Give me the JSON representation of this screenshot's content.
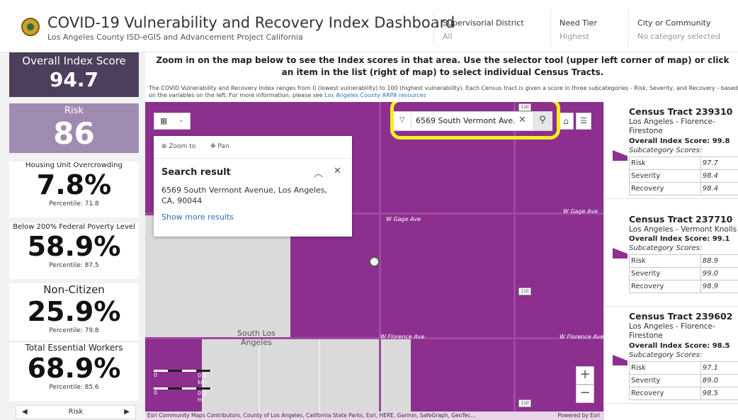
{
  "header": {
    "title": "COVID-19 Vulnerability and Recovery Index Dashboard",
    "subtitle": "Los Angeles County ISD-eGIS and Advancement Project California",
    "filters": [
      {
        "label": "Supervisorial District",
        "value": "All"
      },
      {
        "label": "Need Tier",
        "value": "Highest"
      },
      {
        "label": "City or Community",
        "value": "No category selected"
      }
    ]
  },
  "left": {
    "overall": {
      "label": "Overall Index Score",
      "value": "94.7"
    },
    "risk": {
      "label": "Risk",
      "value": "86"
    },
    "metrics": [
      {
        "label": "Housing Unit Overcrowding",
        "value": "7.8%",
        "percentile": "Percentile: 71.8"
      },
      {
        "label": "Below 200% Federal Poverty Level",
        "value": "58.9%",
        "percentile": "Percentile: 87.5"
      },
      {
        "label": "Non-Citizen",
        "value": "25.9%",
        "percentile": "Percentile: 79.8"
      },
      {
        "label": "Total Essential Workers",
        "value": "68.9%",
        "percentile": "Percentile: 85.6"
      }
    ],
    "pager": {
      "label": "Risk",
      "prev": "◀",
      "next": "▶"
    }
  },
  "instructions": {
    "main": "Zoom in on the map below to see the Index scores in that area. Use the selector tool (upper left corner of map) or click an item in the list (right of map) to select individual Census Tracts.",
    "desc": "The COVID Vulnerability and Recovery Index ranges from 0 (lowest vulnerability) to 100 (highest vulnerability). Each Census tract is given a score in three subcategories - Risk, Severity, and Recovery - based on the variables on the left. For more information, please see",
    "link": "Los Angeles County ARPA resources"
  },
  "map": {
    "popup": {
      "zoom_to": "Zoom to",
      "pan": "Pan",
      "title": "Search result",
      "address": "6569 South Vermont Avenue, Los Angeles, CA, 90044",
      "more": "Show more results"
    },
    "search": {
      "value": "6569 South Vermont Ave."
    },
    "roads": {
      "gage": "W Gage Ave",
      "gage2": "W Gage Ave",
      "florence": "W Florence Ave",
      "florence2": "W Florence Ave"
    },
    "place": "South Los\nAngeles",
    "shields": [
      "110",
      "110",
      "110"
    ],
    "scale": {
      "km": "0.4 km",
      "mi": "0.2 mi",
      "zero": "0"
    },
    "attribution": "Esri Community Maps Contributors, County of Los Angeles, California State Parks, Esri, HERE, Garmin, SafeGraph, GeoTec...",
    "powered": "Powered by Esri",
    "zoom_in": "+",
    "zoom_out": "−"
  },
  "tracts": [
    {
      "title": "Census Tract 239310",
      "location": "Los Angeles - Florence-Firestone",
      "overall": "Overall Index Score: 99.8",
      "sub": "Subcategory Scores:",
      "rows": [
        [
          "Risk",
          "97.7"
        ],
        [
          "Severity",
          "98.4"
        ],
        [
          "Recovery",
          "98.4"
        ]
      ]
    },
    {
      "title": "Census Tract 237710",
      "location": "Los Angeles - Vermont Knolls",
      "overall": "Overall Index Score: 99.1",
      "sub": "Subcategory Scores:",
      "rows": [
        [
          "Risk",
          "88.9"
        ],
        [
          "Severity",
          "99.0"
        ],
        [
          "Recovery",
          "98.9"
        ]
      ]
    },
    {
      "title": "Census Tract 239602",
      "location": "Los Angeles - Florence-Firestone",
      "overall": "Overall Index Score: 98.5",
      "sub": "Subcategory Scores:",
      "rows": [
        [
          "Risk",
          "97.1"
        ],
        [
          "Severity",
          "89.0"
        ],
        [
          "Recovery",
          "98.5"
        ]
      ]
    }
  ],
  "colors": {
    "accent": "#8c2f8f",
    "overall_bg": "#4c3f5b",
    "risk_bg": "#a08bb0",
    "highlight": "#f7ee1e"
  }
}
